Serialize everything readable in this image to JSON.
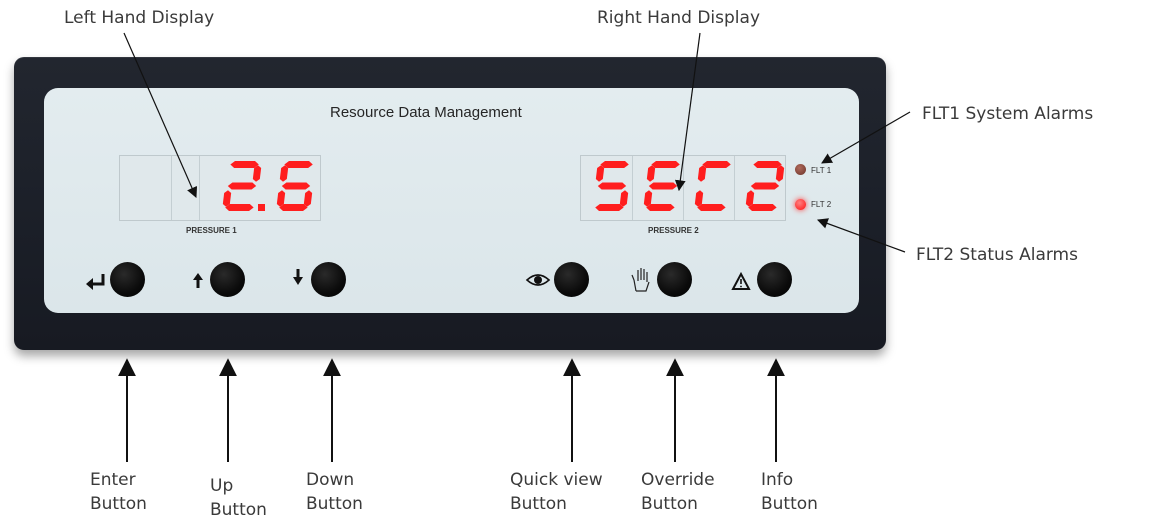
{
  "labels": {
    "left_display": "Left Hand Display",
    "right_display": "Right Hand Display",
    "flt1_alarm": "FLT1 System Alarms",
    "flt2_alarm": "FLT2 Status Alarms"
  },
  "device": {
    "brand": "Resource Data Management",
    "left_display": {
      "value": "2.6",
      "caption": "PRESSURE 1"
    },
    "right_display": {
      "value": "SEC2",
      "caption": "PRESSURE 2"
    },
    "leds": [
      {
        "label": "FLT 1",
        "state": "off",
        "color": "#8a4a3e"
      },
      {
        "label": "FLT 2",
        "state": "on",
        "color": "#ff2a2a"
      }
    ],
    "segment_color": "#ff1e1e"
  },
  "buttons": [
    {
      "line1": "Enter",
      "line2": "Button",
      "icon": "enter-arrow-icon"
    },
    {
      "line1": "Up",
      "line2": "Button",
      "icon": "up-arrow-icon"
    },
    {
      "line1": "Down",
      "line2": "Button",
      "icon": "down-arrow-icon"
    },
    {
      "line1": "Quick view",
      "line2": "Button",
      "icon": "eye-icon"
    },
    {
      "line1": "Override",
      "line2": "Button",
      "icon": "hand-icon"
    },
    {
      "line1": "Info",
      "line2": "Button",
      "icon": "warning-triangle-icon"
    }
  ]
}
